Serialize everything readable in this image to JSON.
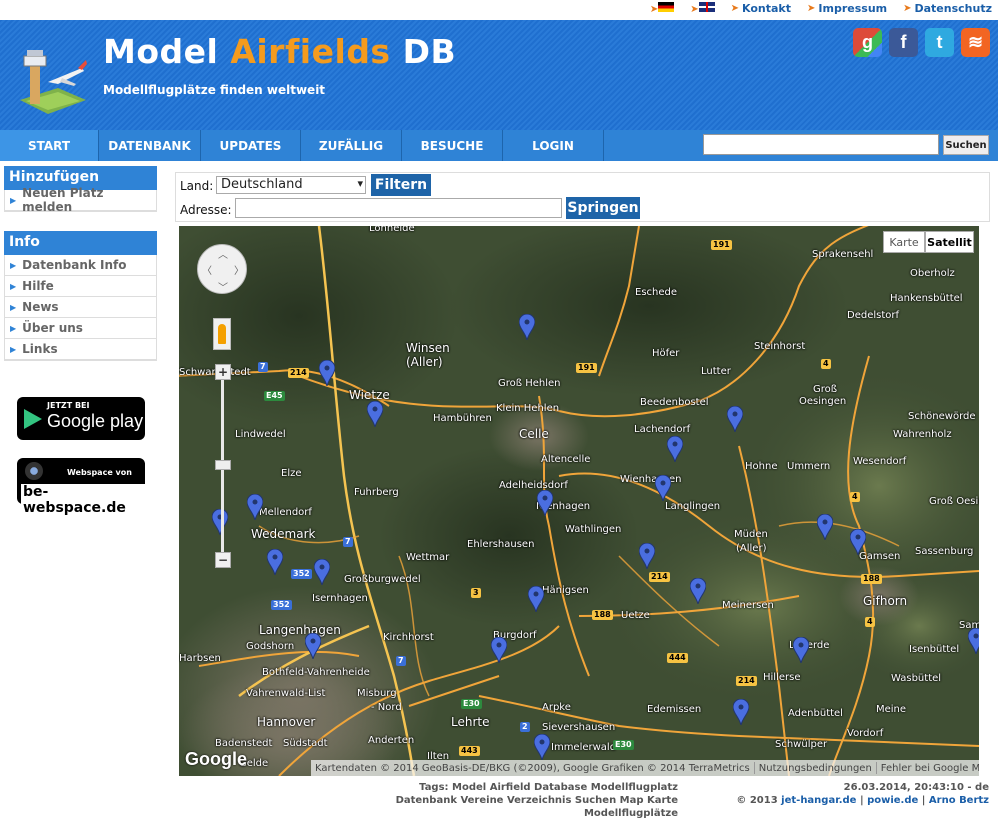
{
  "topbar": {
    "links": [
      {
        "label": "Kontakt"
      },
      {
        "label": "Impressum"
      },
      {
        "label": "Datenschutz"
      }
    ]
  },
  "header": {
    "title_part1": "Model ",
    "title_accent": "Airfields",
    "title_part2": " DB",
    "tagline": "Modellflugplätze finden weltweit",
    "social": [
      {
        "icon": "google-plus-icon",
        "glyph": "g"
      },
      {
        "icon": "facebook-icon",
        "glyph": "f"
      },
      {
        "icon": "twitter-icon",
        "glyph": "t"
      },
      {
        "icon": "rss-icon",
        "glyph": "≋"
      }
    ]
  },
  "nav": {
    "items": [
      {
        "label": "START"
      },
      {
        "label": "DATENBANK"
      },
      {
        "label": "UPDATES"
      },
      {
        "label": "ZUFÄLLIG"
      },
      {
        "label": "BESUCHE"
      },
      {
        "label": "LOGIN"
      }
    ],
    "search_button": "Suchen"
  },
  "sidebar": {
    "add": {
      "heading": "Hinzufügen",
      "items": [
        {
          "label": "Neuen Platz melden"
        }
      ]
    },
    "info": {
      "heading": "Info",
      "items": [
        {
          "label": "Datenbank Info"
        },
        {
          "label": "Hilfe"
        },
        {
          "label": "News"
        },
        {
          "label": "Über uns"
        },
        {
          "label": "Links"
        }
      ]
    },
    "gplay": {
      "small": "JETZT BEI",
      "big": "Google play"
    },
    "bews": {
      "small": "Webspace von",
      "big": "be-webspace.de"
    }
  },
  "filter": {
    "land_label": "Land:",
    "land_value": "Deutschland",
    "filter_button": "Filtern",
    "address_label": "Adresse:",
    "address_value": "",
    "jump_button": "Springen"
  },
  "map": {
    "type_karte": "Karte",
    "type_satellit": "Satellit",
    "google": "Google",
    "attribution": "Kartendaten © 2014 GeoBasis-DE/BKG (©2009), Google Grafiken © 2014 TerraMetrics",
    "terms": "Nutzungsbedingungen",
    "report": "Fehler bei Google Maps melden",
    "places": [
      {
        "name": "Lohheide"
      },
      {
        "name": "Sprakensehl"
      },
      {
        "name": "Oberholz"
      },
      {
        "name": "Eschede"
      },
      {
        "name": "Hankensbüttel"
      },
      {
        "name": "Dedelstorf"
      },
      {
        "name": "Winsen"
      },
      {
        "name": "(Aller)"
      },
      {
        "name": "Höfer"
      },
      {
        "name": "Steinhorst"
      },
      {
        "name": "Lutter"
      },
      {
        "name": "Groß Hehlen"
      },
      {
        "name": "Groß"
      },
      {
        "name": "Oesingen"
      },
      {
        "name": "Wietze"
      },
      {
        "name": "Hambühren"
      },
      {
        "name": "Klein Hehlen"
      },
      {
        "name": "Beedenbostel"
      },
      {
        "name": "Schönewörde"
      },
      {
        "name": "Lindwedel"
      },
      {
        "name": "Celle"
      },
      {
        "name": "Lachendorf"
      },
      {
        "name": "Wahrenholz"
      },
      {
        "name": "Altencelle"
      },
      {
        "name": "Hohne"
      },
      {
        "name": "Ummern"
      },
      {
        "name": "Wesendorf"
      },
      {
        "name": "Elze"
      },
      {
        "name": "Adelheidsdorf"
      },
      {
        "name": "Wienhausen"
      },
      {
        "name": "Fuhrberg"
      },
      {
        "name": "Langlingen"
      },
      {
        "name": "Groß Oesingen"
      },
      {
        "name": "Mellendorf"
      },
      {
        "name": "Nienhagen"
      },
      {
        "name": "Wathlingen"
      },
      {
        "name": "Wedemark"
      },
      {
        "name": "Ehlershausen"
      },
      {
        "name": "Müden"
      },
      {
        "name": "(Aller)"
      },
      {
        "name": "Gamsen"
      },
      {
        "name": "Wettmar"
      },
      {
        "name": "Sassenburg"
      },
      {
        "name": "Großburgwedel"
      },
      {
        "name": "Isernhagen"
      },
      {
        "name": "Hänigsen"
      },
      {
        "name": "Uetze"
      },
      {
        "name": "Meinersen"
      },
      {
        "name": "Gifhorn"
      },
      {
        "name": "Langenhagen"
      },
      {
        "name": "Kirchhorst"
      },
      {
        "name": "Burgdorf"
      },
      {
        "name": "Leiferde"
      },
      {
        "name": "Isenbüttel"
      },
      {
        "name": "Godshorn"
      },
      {
        "name": "Hillerse"
      },
      {
        "name": "Wasbüttel"
      },
      {
        "name": "Bothfeld-Vahrenheide"
      },
      {
        "name": "Vahrenwald-List"
      },
      {
        "name": "Misburg"
      },
      {
        "name": "- Nord"
      },
      {
        "name": "Arpke"
      },
      {
        "name": "Edemissen"
      },
      {
        "name": "Adenbüttel"
      },
      {
        "name": "Meine"
      },
      {
        "name": "Hannover"
      },
      {
        "name": "Lehrte"
      },
      {
        "name": "Sievershausen"
      },
      {
        "name": "Vordorf"
      },
      {
        "name": "Badenstedt"
      },
      {
        "name": "Südstadt"
      },
      {
        "name": "Anderten"
      },
      {
        "name": "Schwülper"
      },
      {
        "name": "Immelerwald"
      },
      {
        "name": "Ilten"
      },
      {
        "name": "Schwarmstedt"
      },
      {
        "name": "Harbsen"
      },
      {
        "name": "Gelde"
      },
      {
        "name": "Sam"
      }
    ],
    "roads": [
      {
        "label": "191"
      },
      {
        "label": "191"
      },
      {
        "label": "214"
      },
      {
        "label": "7"
      },
      {
        "label": "E45"
      },
      {
        "label": "4"
      },
      {
        "label": "4"
      },
      {
        "label": "7"
      },
      {
        "label": "352"
      },
      {
        "label": "352"
      },
      {
        "label": "214"
      },
      {
        "label": "3"
      },
      {
        "label": "188"
      },
      {
        "label": "188"
      },
      {
        "label": "4"
      },
      {
        "label": "444"
      },
      {
        "label": "7"
      },
      {
        "label": "214"
      },
      {
        "label": "E30"
      },
      {
        "label": "2"
      },
      {
        "label": "E30"
      },
      {
        "label": "443"
      }
    ]
  },
  "footer": {
    "tags_line1": "Tags: Model Airfield Database Modellflugplatz",
    "tags_line2": "Datenbank Vereine Verzeichnis Suchen Map Karte",
    "tags_line3": "Modellflugplätze",
    "timestamp": "26.03.2014, 20:43:10 - de",
    "copyright": "© 2013",
    "link1": "jet-hangar.de",
    "sep1": "|",
    "link2": "powie.de",
    "sep2": "|",
    "link3": "Arno Bertz"
  },
  "colors": {
    "brand_blue": "#2f83d6",
    "accent_orange": "#f49b1e",
    "button_blue": "#1e64a8",
    "pin_blue": "#4a6ee0"
  }
}
